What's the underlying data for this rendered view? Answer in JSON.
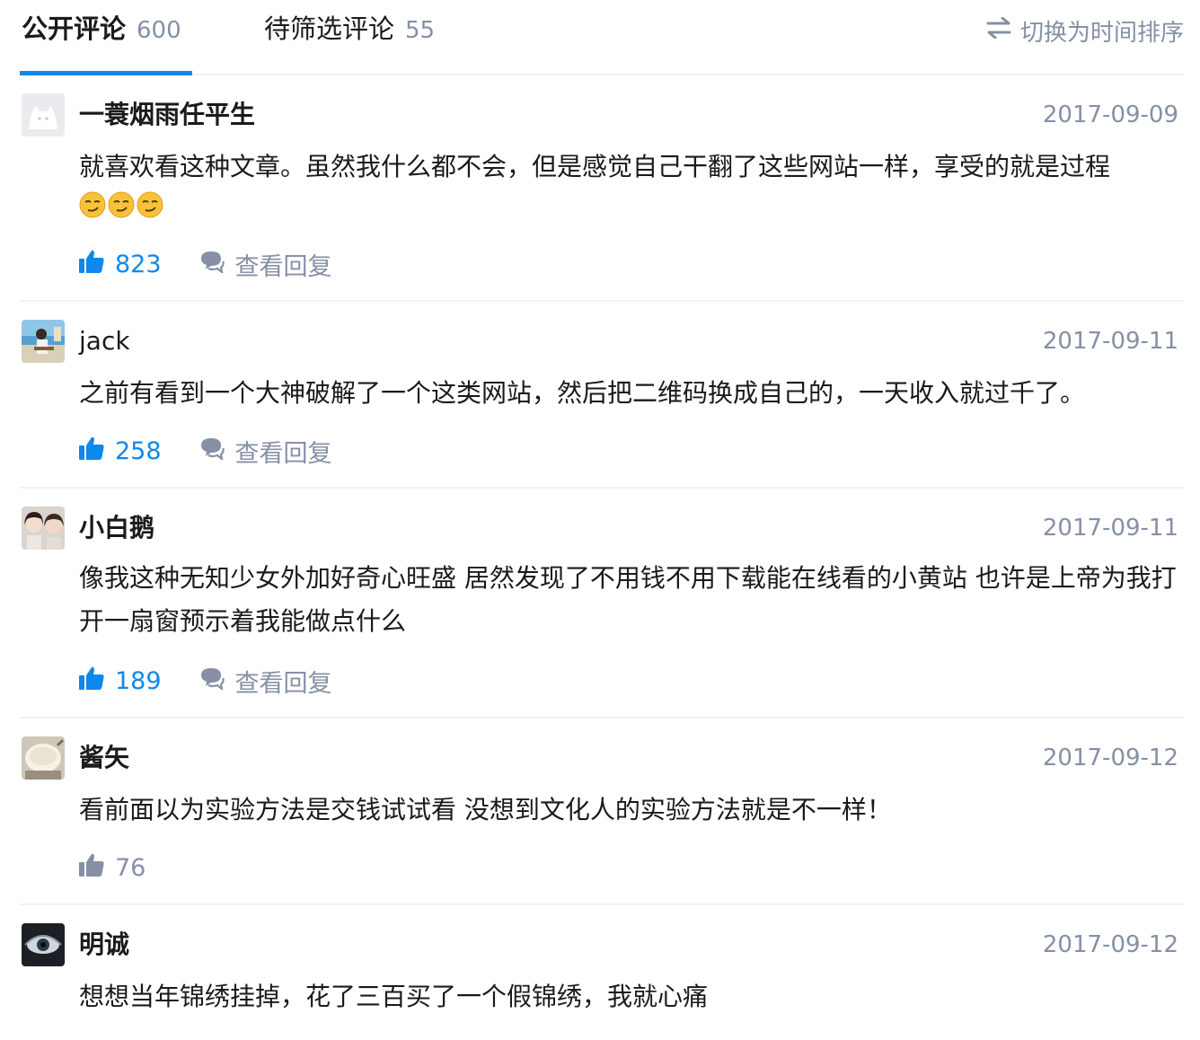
{
  "tabs": {
    "public": {
      "label": "公开评论",
      "count": "600"
    },
    "pending": {
      "label": "待筛选评论",
      "count": "55"
    },
    "sort_label": "切换为时间排序"
  },
  "colors": {
    "accent": "#0f88eb",
    "muted": "#8590a6",
    "divider": "#f0f2f5"
  },
  "comments": [
    {
      "author": "一蓑烟雨任平生",
      "date": "2017-09-09",
      "text": "就喜欢看这种文章。虽然我什么都不会，但是感觉自己干翻了这些网站一样，享受的就是过程",
      "emojis": [
        "😏",
        "😏",
        "😏"
      ],
      "likes": "823",
      "reply_label": "查看回复"
    },
    {
      "author": "jack",
      "date": "2017-09-11",
      "text": "之前有看到一个大神破解了一个这类网站，然后把二维码换成自己的，一天收入就过千了。",
      "likes": "258",
      "reply_label": "查看回复"
    },
    {
      "author": "小白鹅",
      "date": "2017-09-11",
      "text": "像我这种无知少女外加好奇心旺盛 居然发现了不用钱不用下载能在线看的小黄站 也许是上帝为我打开一扇窗预示着我能做点什么",
      "likes": "189",
      "reply_label": "查看回复"
    },
    {
      "author": "酱矢",
      "date": "2017-09-12",
      "text": "看前面以为实验方法是交钱试试看 没想到文化人的实验方法就是不一样！",
      "likes": "76"
    },
    {
      "author": "明诚",
      "date": "2017-09-12",
      "text": "想想当年锦绣挂掉，花了三百买了一个假锦绣，我就心痛"
    }
  ]
}
